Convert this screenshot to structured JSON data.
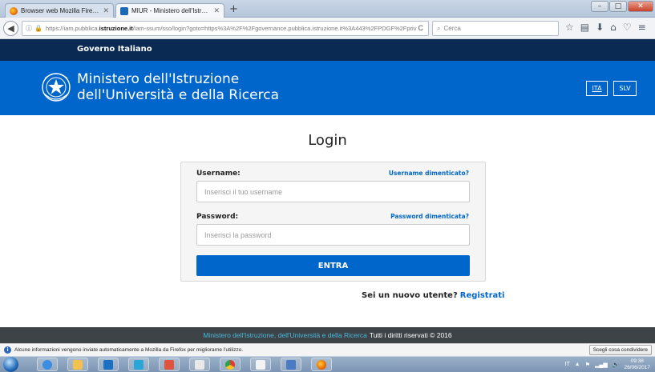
{
  "browser": {
    "tabs": [
      {
        "title": "Browser web Mozilla Firefox",
        "active": false
      },
      {
        "title": "MIUR - Ministero dell'Istruzio",
        "active": true
      }
    ],
    "new_tab": "+",
    "url_prefix": "https://iam.pubblica.",
    "url_domain": "istruzione.it",
    "url_rest": "/iam-ssum/sso/login?goto=https%3A%2F%2Fgovernance.pubblica.istruzione.it%3A443%2FPDGF%2Fpriv",
    "search_placeholder": "Cerca",
    "reload_glyph": "C"
  },
  "gov_bar": {
    "label": "Governo Italiano"
  },
  "header": {
    "ministry_line1": "Ministero dell'Istruzione",
    "ministry_line2": "dell'Università e della Ricerca",
    "lang_ita": "ITA",
    "lang_slv": "SLV"
  },
  "login": {
    "title": "Login",
    "username_label": "Username:",
    "username_forgot": "Username dimenticato?",
    "username_placeholder": "Inserisci il tuo username",
    "password_label": "Password:",
    "password_forgot": "Password dimenticata?",
    "password_placeholder": "Inserisci la password",
    "submit": "ENTRA"
  },
  "register": {
    "question": "Sei un nuovo utente?",
    "link": "Registrati"
  },
  "footer": {
    "ministry": "Ministero dell'Istruzione, dell'Università e della Ricerca",
    "rights": "Tutti i diritti riservati © 2016"
  },
  "notification": {
    "text": "Alcune informazioni vengono inviate automaticamente a Mozilla da Firefox per migliorarne l'utilizzo.",
    "button": "Scegli cosa condividere"
  },
  "taskbar": {
    "lang": "IT",
    "time": "09:38",
    "date": "26/06/2017"
  },
  "colors": {
    "header_blue": "#0066cc",
    "gov_navy": "#0a2a54",
    "footer_gray": "#3d4347"
  }
}
